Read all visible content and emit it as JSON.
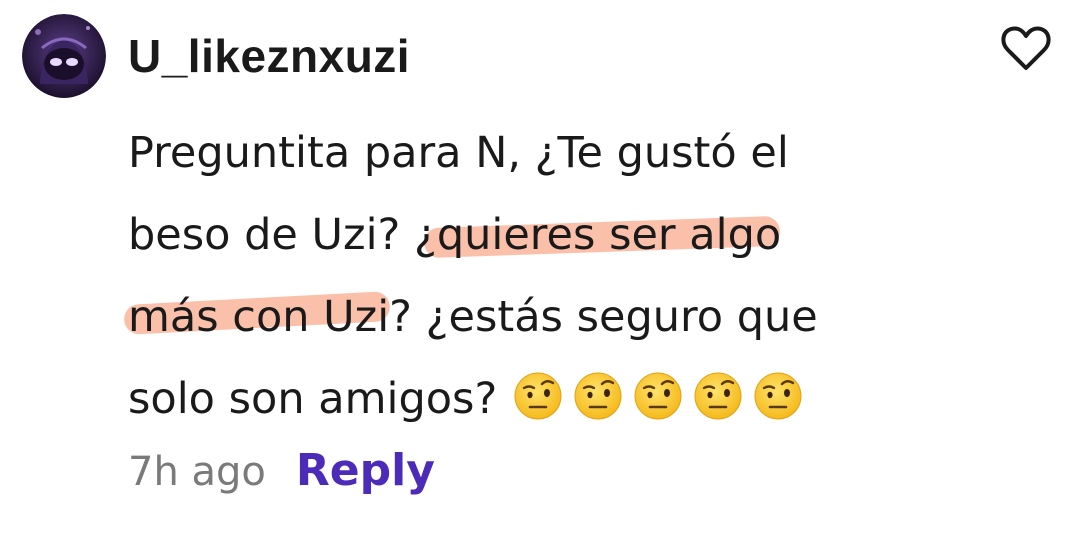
{
  "comment": {
    "username": "U_likeznxuzi",
    "avatar_icon": "avatar-dark-purple",
    "text_lines": [
      "Preguntita para N, ¿Te gustó el",
      "beso de Uzi? ¿quieres ser algo",
      "más con Uzi? ¿estás seguro que",
      "solo son amigos?"
    ],
    "emoji_count": 5,
    "emoji_name": "face-with-raised-eyebrow",
    "timestamp": "7h ago",
    "reply_label": "Reply",
    "like_icon": "heart-outline-icon"
  },
  "colors": {
    "reply": "#4c2bb8",
    "highlight": "#f78c64",
    "timestamp": "#7a7a7a",
    "text": "#1a1a1a"
  }
}
